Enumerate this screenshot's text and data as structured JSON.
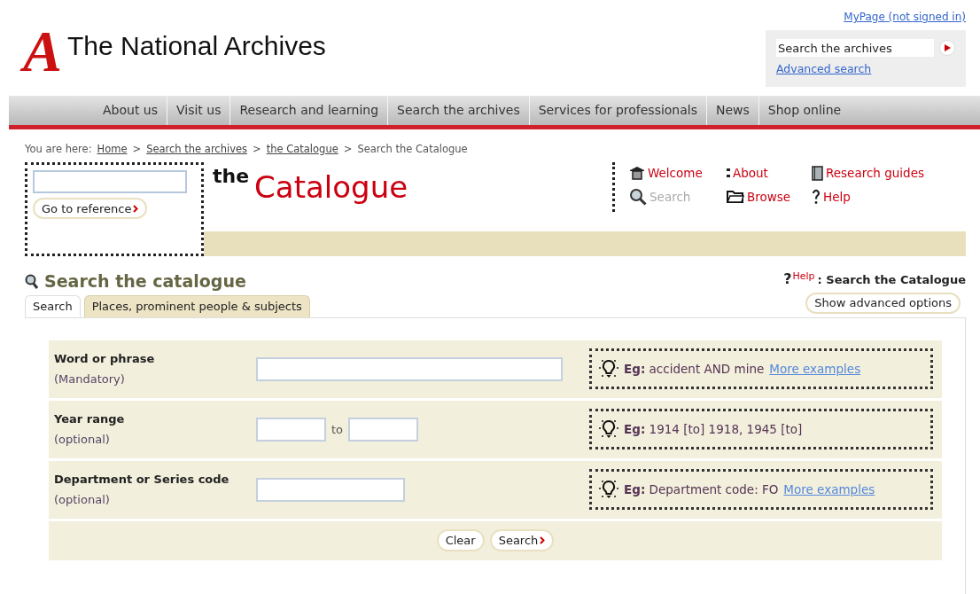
{
  "header": {
    "logo_mark": "A",
    "site_title": "The National Archives",
    "mypage_link": "MyPage (not signed in)",
    "search": {
      "value": "Search the archives"
    },
    "advanced_link": "Advanced search"
  },
  "nav": [
    "About us",
    "Visit us",
    "Research and learning",
    "Search the archives",
    "Services for professionals",
    "News",
    "Shop online"
  ],
  "breadcrumb": {
    "label": "You are here:",
    "links": [
      "Home",
      "Search the archives",
      "the Catalogue"
    ],
    "current": "Search the Catalogue",
    "separator": ">"
  },
  "reference_box": {
    "button": "Go to reference"
  },
  "catalogue_title": {
    "small": "the",
    "large": "Catalogue"
  },
  "catalogue_nav": [
    {
      "kind": "house",
      "label": "Welcome",
      "selected": false
    },
    {
      "kind": "colon",
      "label": "About",
      "selected": false
    },
    {
      "kind": "book",
      "label": "Research guides",
      "selected": false
    },
    {
      "kind": "search",
      "label": "Search",
      "selected": true
    },
    {
      "kind": "folder",
      "label": "Browse",
      "selected": false
    },
    {
      "kind": "help",
      "label": "Help",
      "selected": false
    }
  ],
  "page_heading": "Search the catalogue",
  "help": {
    "mark": "?",
    "link": "Help",
    "context": ": Search the Catalogue"
  },
  "tabs": [
    {
      "label": "Search",
      "selected": true
    },
    {
      "label": "Places, prominent people & subjects",
      "selected": false
    }
  ],
  "advanced_button": "Show advanced options",
  "form_rows": [
    {
      "kind": "single",
      "label": "Word or phrase",
      "note": "(Mandatory)",
      "hint": "**Eg:** accident AND mine",
      "hint_link": "More examples"
    },
    {
      "kind": "range",
      "label": "Year range",
      "note": "(optional)",
      "joiner": "to",
      "hint": "**Eg:** 1914 [to] 1918, 1945 [to]"
    },
    {
      "kind": "short",
      "label": "Department or Series code",
      "note": "(optional)",
      "hint": "**Eg:** Department code: FO",
      "hint_link": "More examples"
    }
  ],
  "form_buttons": {
    "clear": "Clear",
    "search": "Search"
  }
}
